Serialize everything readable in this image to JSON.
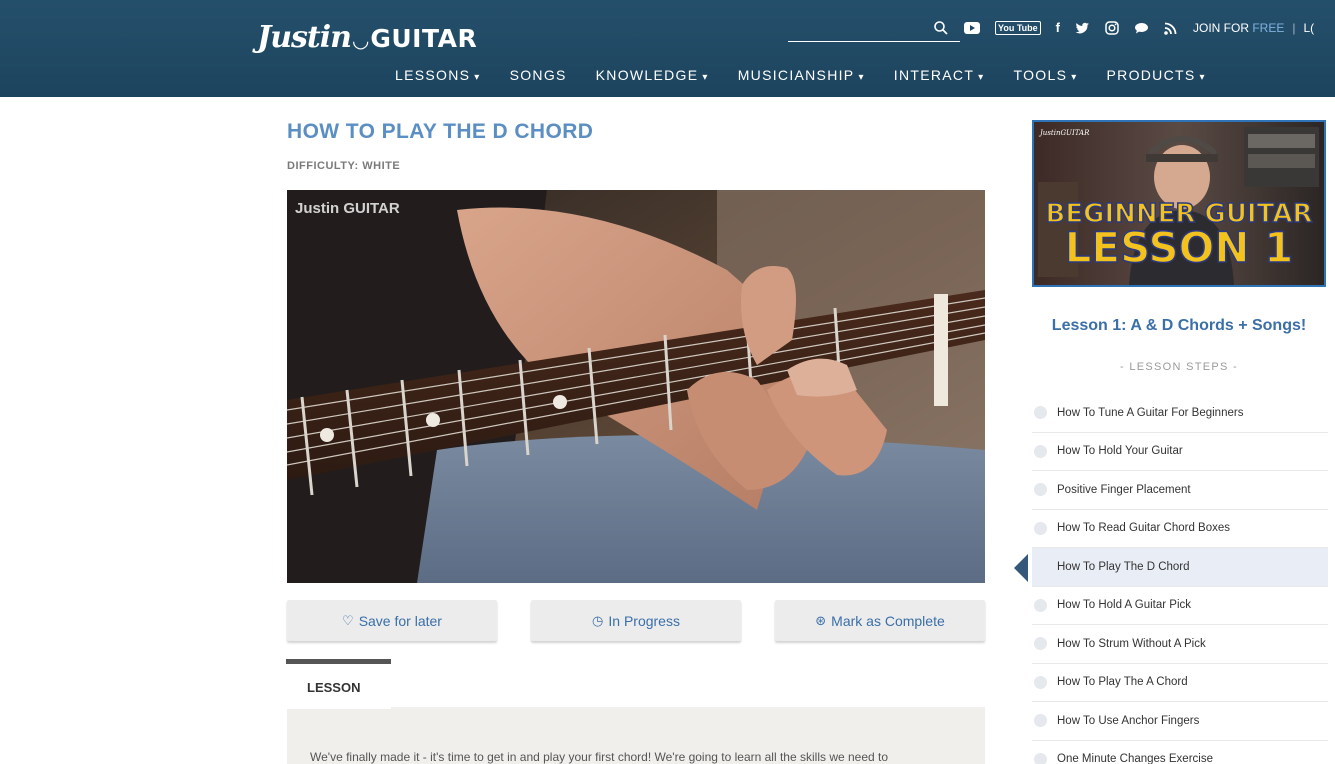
{
  "header": {
    "logo_script": "Justin",
    "logo_word": "GUITAR",
    "join_label": "JOIN FOR",
    "join_free": "FREE",
    "separator": "|",
    "login_cut": "L(",
    "youtube_word": "You Tube",
    "social_icons": [
      "search-icon",
      "youtube-icon",
      "youtube-logo-icon",
      "facebook-icon",
      "twitter-icon",
      "instagram-icon",
      "chat-icon",
      "rss-icon"
    ]
  },
  "nav": [
    {
      "label": "LESSONS",
      "dropdown": true
    },
    {
      "label": "SONGS",
      "dropdown": false
    },
    {
      "label": "KNOWLEDGE",
      "dropdown": true
    },
    {
      "label": "MUSICIANSHIP",
      "dropdown": true
    },
    {
      "label": "INTERACT",
      "dropdown": true
    },
    {
      "label": "TOOLS",
      "dropdown": true
    },
    {
      "label": "PRODUCTS",
      "dropdown": true
    }
  ],
  "main": {
    "title": "HOW TO PLAY THE D CHORD",
    "difficulty": "DIFFICULTY: WHITE",
    "video_watermark": "Justin GUITAR",
    "buttons": {
      "save": "Save for later",
      "progress": "In Progress",
      "complete": "Mark as Complete"
    },
    "tab_label": "LESSON",
    "lesson_intro": "We've finally made it - it's time to get in and play your first chord! We're going to learn all the skills we need to"
  },
  "sidebar": {
    "promo_brand": "JustinGUITAR",
    "promo_line1": "BEGINNER GUITAR",
    "promo_line2": "LESSON 1",
    "title": "Lesson 1: A & D Chords + Songs!",
    "subtitle": "- LESSON STEPS -",
    "steps": [
      "How To Tune A Guitar For Beginners",
      "How To Hold Your Guitar",
      "Positive Finger Placement",
      "How To Read Guitar Chord Boxes",
      "How To Play The D Chord",
      "How To Hold A Guitar Pick",
      "How To Strum Without A Pick",
      "How To Play The A Chord",
      "How To Use Anchor Fingers",
      "One Minute Changes Exercise"
    ],
    "active_step": 4
  },
  "colors": {
    "header_bg": "#1f4661",
    "title_blue": "#5b8fc4",
    "link_blue": "#3a6fa8",
    "accent_free": "#7fb3e0",
    "promo_border": "#2e73b8"
  }
}
